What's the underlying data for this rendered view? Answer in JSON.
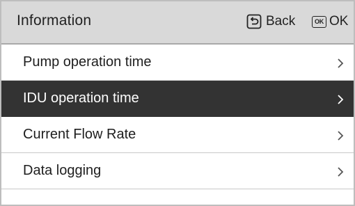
{
  "header": {
    "title": "Information",
    "back_label": "Back",
    "ok_icon_text": "OK",
    "ok_label": "OK"
  },
  "menu": {
    "selected_index": 1,
    "items": [
      {
        "label": "Pump operation time",
        "icon": "chevron-right-icon"
      },
      {
        "label": "IDU operation time",
        "icon": "chevron-right-icon"
      },
      {
        "label": "Current Flow Rate",
        "icon": "chevron-right-icon"
      },
      {
        "label": "Data logging",
        "icon": "chevron-right-icon"
      }
    ]
  },
  "colors": {
    "header_bg": "#d9d9d9",
    "selected_bg": "#333333",
    "text": "#1e1e1e",
    "selected_text": "#ffffff"
  }
}
